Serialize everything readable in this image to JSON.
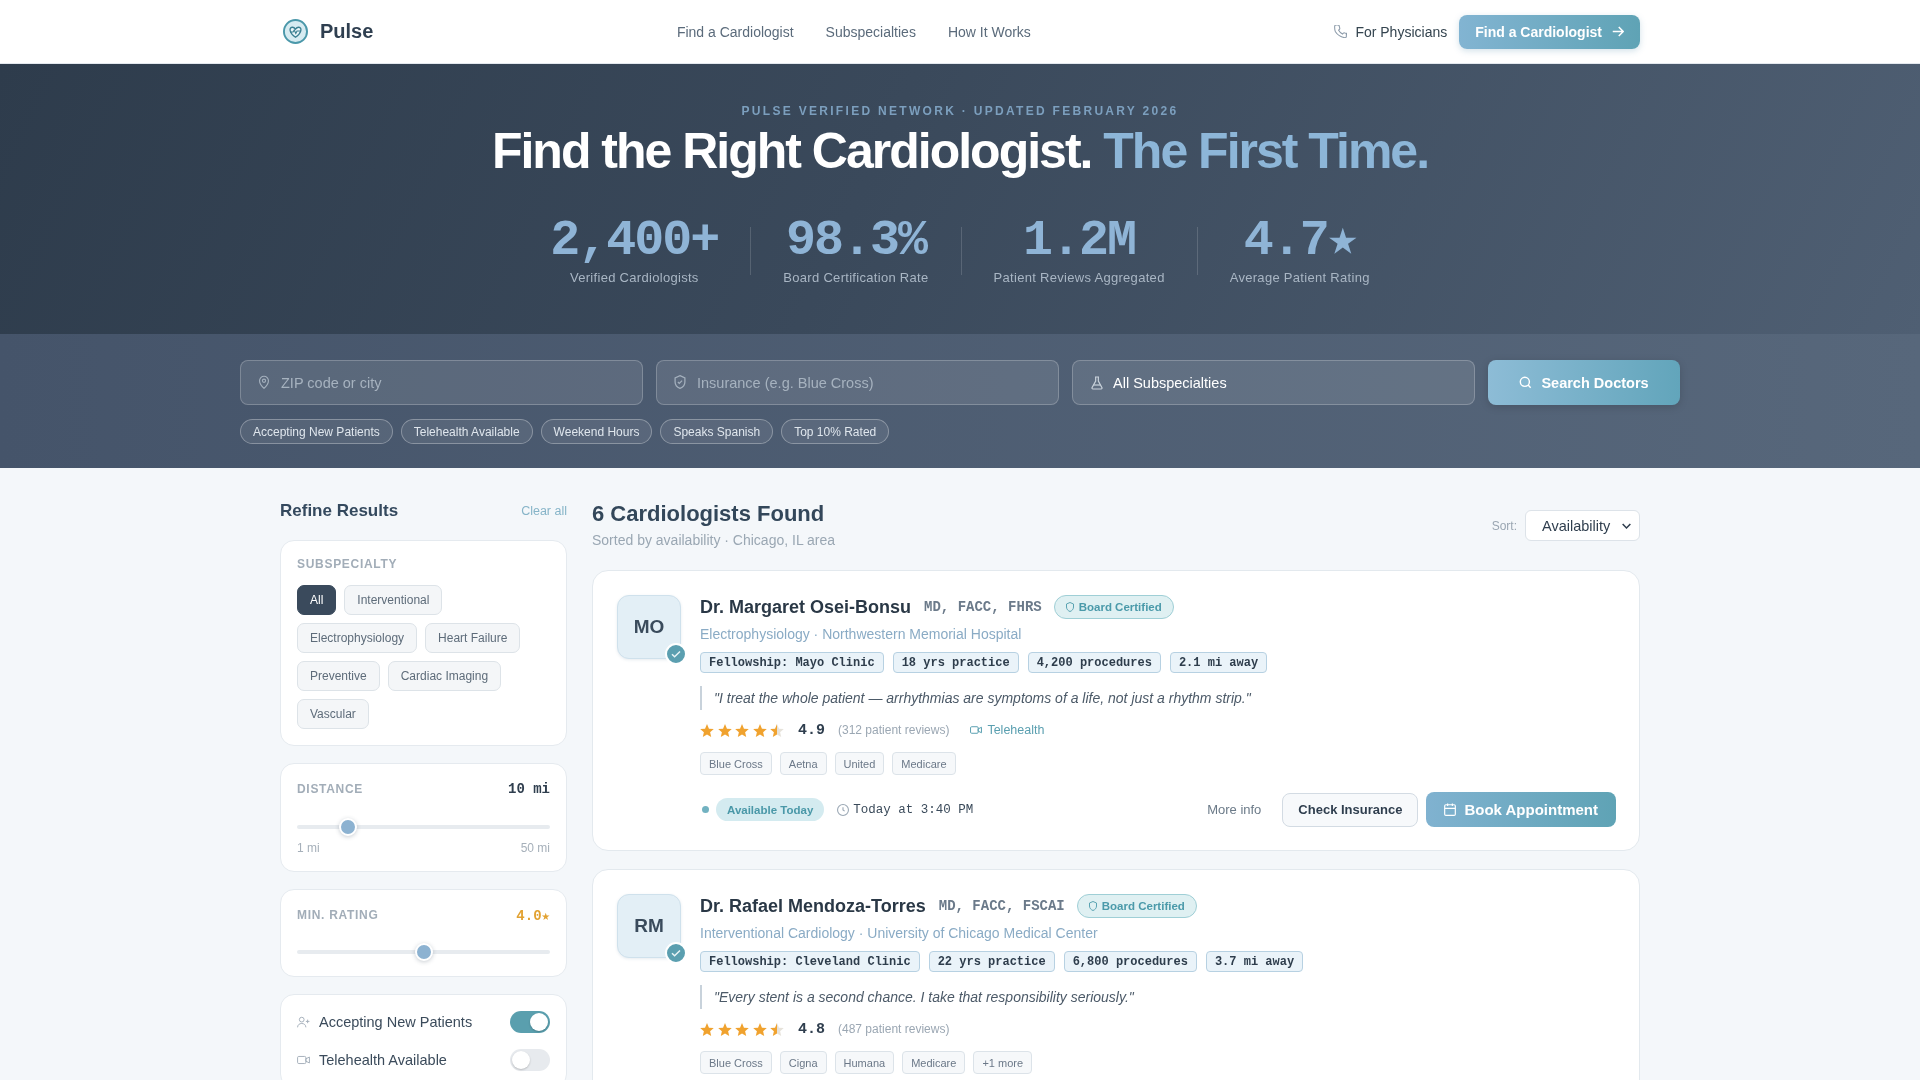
{
  "header": {
    "brand": "Pulse",
    "nav": [
      {
        "label": "Find a Cardiologist"
      },
      {
        "label": "Subspecialties"
      },
      {
        "label": "How It Works"
      }
    ],
    "physicians_link": "For Physicians",
    "cta": "Find a Cardiologist"
  },
  "hero": {
    "eyebrow": "PULSE VERIFIED NETWORK · UPDATED FEBRUARY 2026",
    "title": "Find the Right Cardiologist.",
    "title_accent": "The First Time.",
    "stats": [
      {
        "value": "2,400+",
        "label": "Verified Cardiologists"
      },
      {
        "value": "98.3%",
        "label": "Board Certification Rate"
      },
      {
        "value": "1.2M",
        "label": "Patient Reviews Aggregated"
      },
      {
        "value": "4.7★",
        "label": "Average Patient Rating"
      }
    ]
  },
  "search": {
    "fields": [
      {
        "kind": "location",
        "placeholder": "ZIP code or city"
      },
      {
        "kind": "insurance",
        "placeholder": "Insurance (e.g. Blue Cross)"
      },
      {
        "kind": "specialty",
        "value": "All Subspecialties"
      }
    ],
    "button": "Search Doctors",
    "quick_filters": [
      {
        "label": "Accepting New Patients",
        "selected": false
      },
      {
        "label": "Telehealth Available",
        "selected": false
      },
      {
        "label": "Weekend Hours",
        "selected": false
      },
      {
        "label": "Speaks Spanish",
        "selected": false
      },
      {
        "label": "Top 10% Rated",
        "selected": false
      }
    ]
  },
  "sidebar": {
    "title": "Refine Results",
    "clear": "Clear all",
    "subspecialty": {
      "heading": "SUBSPECIALTY",
      "options": [
        {
          "label": "All",
          "selected": true
        },
        {
          "label": "Interventional",
          "selected": false
        },
        {
          "label": "Electrophysiology",
          "selected": false
        },
        {
          "label": "Heart Failure",
          "selected": false
        },
        {
          "label": "Preventive",
          "selected": false
        },
        {
          "label": "Cardiac Imaging",
          "selected": false
        },
        {
          "label": "Vascular",
          "selected": false
        }
      ]
    },
    "distance": {
      "heading": "DISTANCE",
      "reading": "10 mi",
      "level": 0.2,
      "min_label": "1 mi",
      "max_label": "50 mi"
    },
    "rating": {
      "heading": "MIN. RATING",
      "reading": "4.0★",
      "level": 0.5
    },
    "toggles": [
      {
        "kind": "patients",
        "label": "Accepting New Patients",
        "on": true
      },
      {
        "kind": "telehealth",
        "label": "Telehealth Available",
        "on": false
      }
    ]
  },
  "results": {
    "title": "6 Cardiologists Found",
    "subtitle": "Sorted by availability · Chicago, IL area",
    "sort": {
      "label": "Sort:",
      "value": "Availability"
    },
    "doctors": [
      {
        "initials": "MO",
        "verified": true,
        "name": "Dr. Margaret Osei-Bonsu",
        "credentials": "MD, FACC, FHRS",
        "badge": "Board Certified",
        "subtitle": "Electrophysiology · Northwestern Memorial Hospital",
        "tags": [
          "Fellowship: Mayo Clinic",
          "18 yrs practice",
          "4,200 procedures",
          "2.1 mi away"
        ],
        "quote": "\"I treat the whole patient — arrhythmias are symptoms of a life, not just a rhythm strip.\"",
        "stars": 4.5,
        "rating": "4.9",
        "reviews": "(312 patient reviews)",
        "telehealth": "Telehealth",
        "insurance": [
          "Blue Cross",
          "Aetna",
          "United",
          "Medicare"
        ],
        "availability": {
          "status": "Available Today",
          "time": "Today at 3:40 PM"
        },
        "actions": {
          "more": "More info",
          "check": "Check Insurance",
          "book": "Book Appointment"
        }
      },
      {
        "initials": "RM",
        "verified": true,
        "name": "Dr. Rafael Mendoza-Torres",
        "credentials": "MD, FACC, FSCAI",
        "badge": "Board Certified",
        "subtitle": "Interventional Cardiology · University of Chicago Medical Center",
        "tags": [
          "Fellowship: Cleveland Clinic",
          "22 yrs practice",
          "6,800 procedures",
          "3.7 mi away"
        ],
        "quote": "\"Every stent is a second chance. I take that responsibility seriously.\"",
        "stars": 4.5,
        "rating": "4.8",
        "reviews": "(487 patient reviews)",
        "insurance": [
          "Blue Cross",
          "Cigna",
          "Humana",
          "Medicare",
          "+1 more"
        ]
      }
    ]
  }
}
